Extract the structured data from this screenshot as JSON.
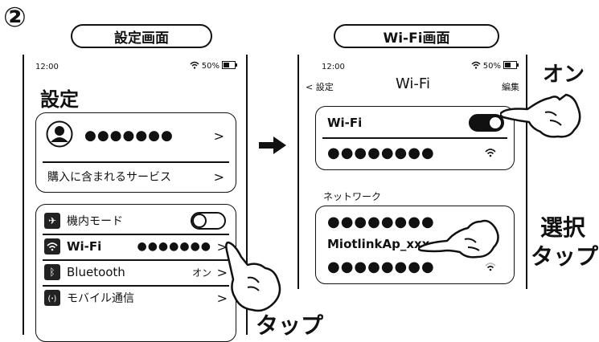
{
  "step_number": "②",
  "left_screen": {
    "title_pill": "設定画面",
    "status_time": "12:00",
    "status_battery": "50%",
    "page_title": "設定",
    "account": {
      "name_dots": "●●●●●●●",
      "chevron": ">"
    },
    "purchased": {
      "label": "購入に含まれるサービス",
      "chevron": ">"
    },
    "settings": [
      {
        "label": "機内モード",
        "icon": "airplane-icon"
      },
      {
        "label": "Wi-Fi",
        "value": "●●●●●●●",
        "chevron": ">",
        "icon": "wifi-icon"
      },
      {
        "label": "Bluetooth",
        "value": "オン",
        "chevron": ">",
        "icon": "bluetooth-icon"
      },
      {
        "label": "モバイル通信",
        "chevron": ">",
        "icon": "antenna-icon"
      }
    ]
  },
  "right_screen": {
    "title_pill": "Wi-Fi画面",
    "status_time": "12:00",
    "status_battery": "50%",
    "nav_back": "< 設定",
    "nav_title": "Wi-Fi",
    "nav_edit": "編集",
    "wifi_label": "Wi-Fi",
    "connected_network": "●●●●●●●●",
    "network_section": "ネットワーク",
    "networks": [
      "●●●●●●●●",
      "MiotlinkAp_xxx",
      "●●●●●●●●"
    ]
  },
  "callouts": {
    "on": "オン",
    "select": "選択",
    "tap_right": "タップ",
    "tap_bottom": "タップ"
  }
}
